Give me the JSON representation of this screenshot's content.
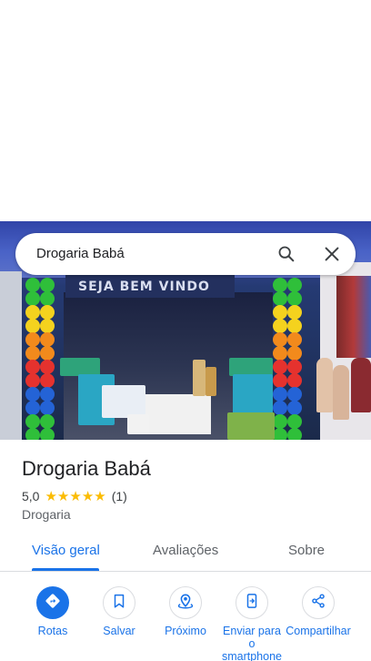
{
  "search": {
    "query": "Drogaria Babá"
  },
  "hero": {
    "sign_text": "SEJA BEM VINDO"
  },
  "place": {
    "name": "Drogaria Babá",
    "rating": "5,0",
    "stars": 5,
    "review_count": "(1)",
    "category": "Drogaria"
  },
  "tabs": [
    {
      "label": "Visão geral",
      "active": true
    },
    {
      "label": "Avaliações",
      "active": false
    },
    {
      "label": "Sobre",
      "active": false
    }
  ],
  "actions": [
    {
      "label": "Rotas",
      "icon": "directions-icon",
      "primary": true
    },
    {
      "label": "Salvar",
      "icon": "bookmark-icon",
      "primary": false
    },
    {
      "label": "Próximo",
      "icon": "nearby-icon",
      "primary": false
    },
    {
      "label": "Enviar para o smartphone",
      "icon": "send-to-phone-icon",
      "primary": false
    },
    {
      "label": "Compartilhar",
      "icon": "share-icon",
      "primary": false
    }
  ],
  "colors": {
    "accent": "#1a73e8",
    "star": "#fbbc04",
    "text": "#202124",
    "secondary_text": "#5f6368"
  }
}
